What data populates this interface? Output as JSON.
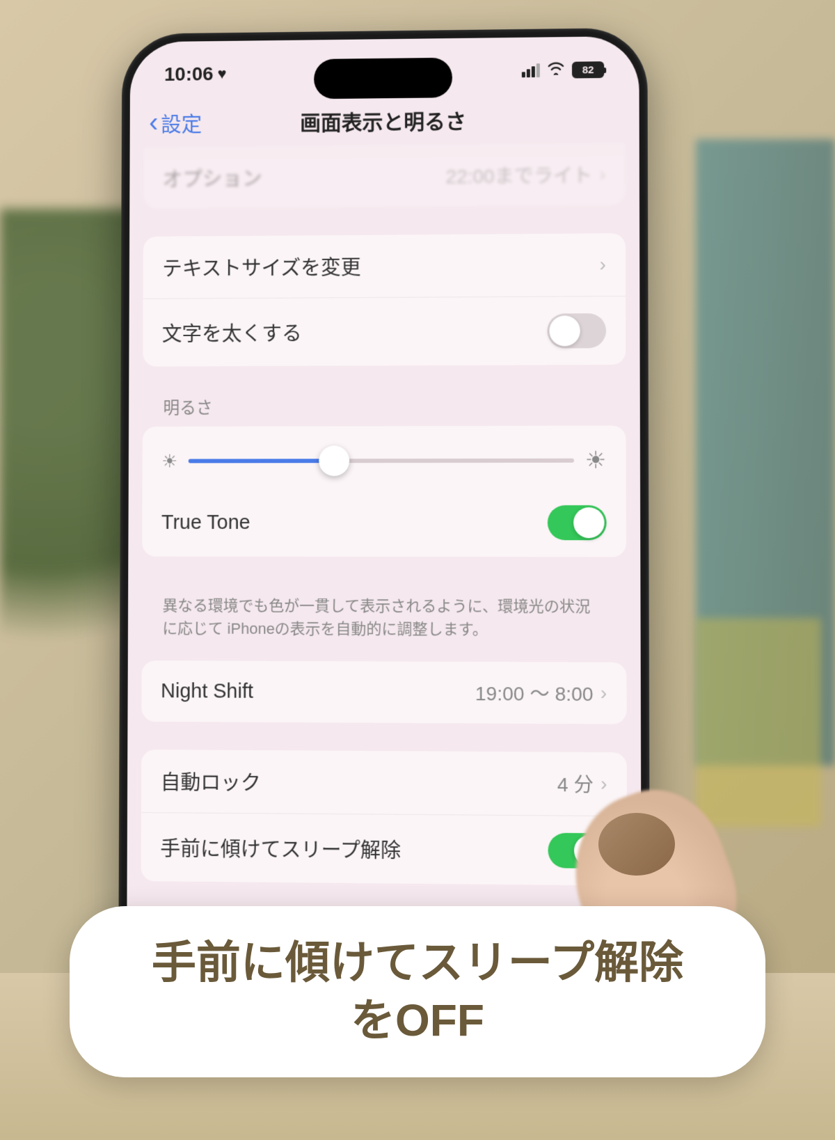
{
  "status_bar": {
    "time": "10:06",
    "battery": "82"
  },
  "nav": {
    "back_label": "設定",
    "title": "画面表示と明るさ"
  },
  "partial_row": {
    "label": "オプション",
    "value": "22:00までライト"
  },
  "text_section": {
    "text_size": "テキストサイズを変更",
    "bold_text": "文字を太くする"
  },
  "brightness": {
    "header": "明るさ",
    "true_tone": "True Tone",
    "footer": "異なる環境でも色が一貫して表示されるように、環境光の状況に応じて iPhoneの表示を自動的に調整します。",
    "slider_percent": 38
  },
  "night_shift": {
    "label": "Night Shift",
    "value": "19:00 ～ 8:00"
  },
  "auto_lock": {
    "label": "自動ロック",
    "value": "4 分"
  },
  "raise_to_wake": {
    "label": "手前に傾けてスリープ解除"
  },
  "caption": "手前に傾けてスリープ解除\nをOFF"
}
